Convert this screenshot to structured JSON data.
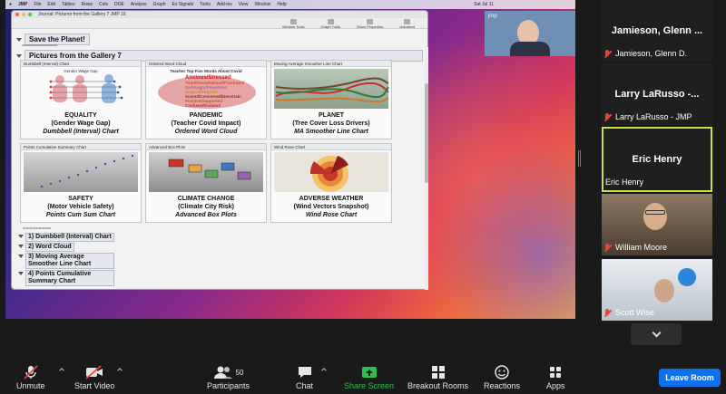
{
  "share": {
    "menubar": {
      "app": "JMP",
      "items": [
        "File",
        "Edit",
        "Tables",
        "Rows",
        "Cols",
        "DOE",
        "Analyze",
        "Graph",
        "Ex Signals",
        "Tools",
        "Add-ins",
        "View",
        "Window",
        "Help"
      ],
      "clock": "Sat Jul 11"
    },
    "jmp_window": {
      "title": "Journal: Pictures from the Gallery 7 JMP 16",
      "toolbar": [
        "Window Tools",
        "Graph Tools",
        "Show Properties",
        "Unlocked"
      ],
      "save_title": "Save the Planet!",
      "separator": "=============",
      "section_title": "Pictures from the Gallery 7",
      "panels": [
        {
          "header": "Dumbbell (Interval) Chart",
          "l1": "EQUALITY",
          "l2": "(Gender Wage Gap)",
          "l3": "Dumbbell (Interval) Chart"
        },
        {
          "header": "Ordered Word Cloud",
          "l1": "PANDEMIC",
          "l2": "(Teacher Covid Impact)",
          "l3": "Ordered Word Cloud"
        },
        {
          "header": "Moving Average Smoother Line Chart",
          "l1": "PLANET",
          "l2": "(Tree Cover Loss Drivers)",
          "l3": "MA Smoother Line Chart"
        },
        {
          "header": "Points Cumulative Summary Chart",
          "l1": "SAFETY",
          "l2": "(Motor Vehicle Safety)",
          "l3": "Points Cum Sum Chart"
        },
        {
          "header": "Advanced Box Plots",
          "l1": "CLIMATE CHANGE",
          "l2": "(Climate City Risk)",
          "l3": "Advanced Box Plots"
        },
        {
          "header": "Wind Rose Chart",
          "l1": "ADVERSE WEATHER",
          "l2": "(Wind Vectors Snapshot)",
          "l3": "Wind Rose Chart"
        }
      ],
      "panel_chart_titles": {
        "equality": "Gender Wage Gap",
        "pandemic": "Teacher Top Five Words About Covid",
        "words": [
          "Anxious/Stressed",
          "Tired/Overwhelmed/Frustrated",
          "Sad/Angry/Powerless",
          "Inspired/Hopeful",
          "Scared/Concerned/Uncertain",
          "Positive/Supported",
          "Confused/Isolated"
        ]
      },
      "list_separator": "=========",
      "list": [
        "1) Dumbbell (Interval) Chart",
        "2) Word Cloud",
        "3) Moving Average Smoother Line Chart",
        "4) Points Cumulative Summary Chart"
      ]
    },
    "presenter_cam_label": "jmp"
  },
  "participants": [
    {
      "big": "Jamieson,  Glenn ...",
      "label": "Jamieson, Glenn D.",
      "muted": true
    },
    {
      "big": "Larry LaRusso -...",
      "label": "Larry LaRusso - JMP",
      "muted": true
    },
    {
      "big": "Eric Henry",
      "label": "Eric Henry",
      "muted": false
    },
    {
      "big": "",
      "label": "William Moore",
      "muted": true
    },
    {
      "big": "",
      "label": "Scott Wise",
      "muted": true
    }
  ],
  "toolbar": {
    "unmute": "Unmute",
    "start_video": "Start Video",
    "participants": "Participants",
    "participants_count": "50",
    "chat": "Chat",
    "share_screen": "Share Screen",
    "breakout": "Breakout Rooms",
    "reactions": "Reactions",
    "apps": "Apps",
    "leave": "Leave Room"
  },
  "colors": {
    "share_green": "#2fbf4e",
    "leave_blue": "#0e71eb",
    "active_speaker": "#c9e04a",
    "mute_red": "#e5463a"
  }
}
